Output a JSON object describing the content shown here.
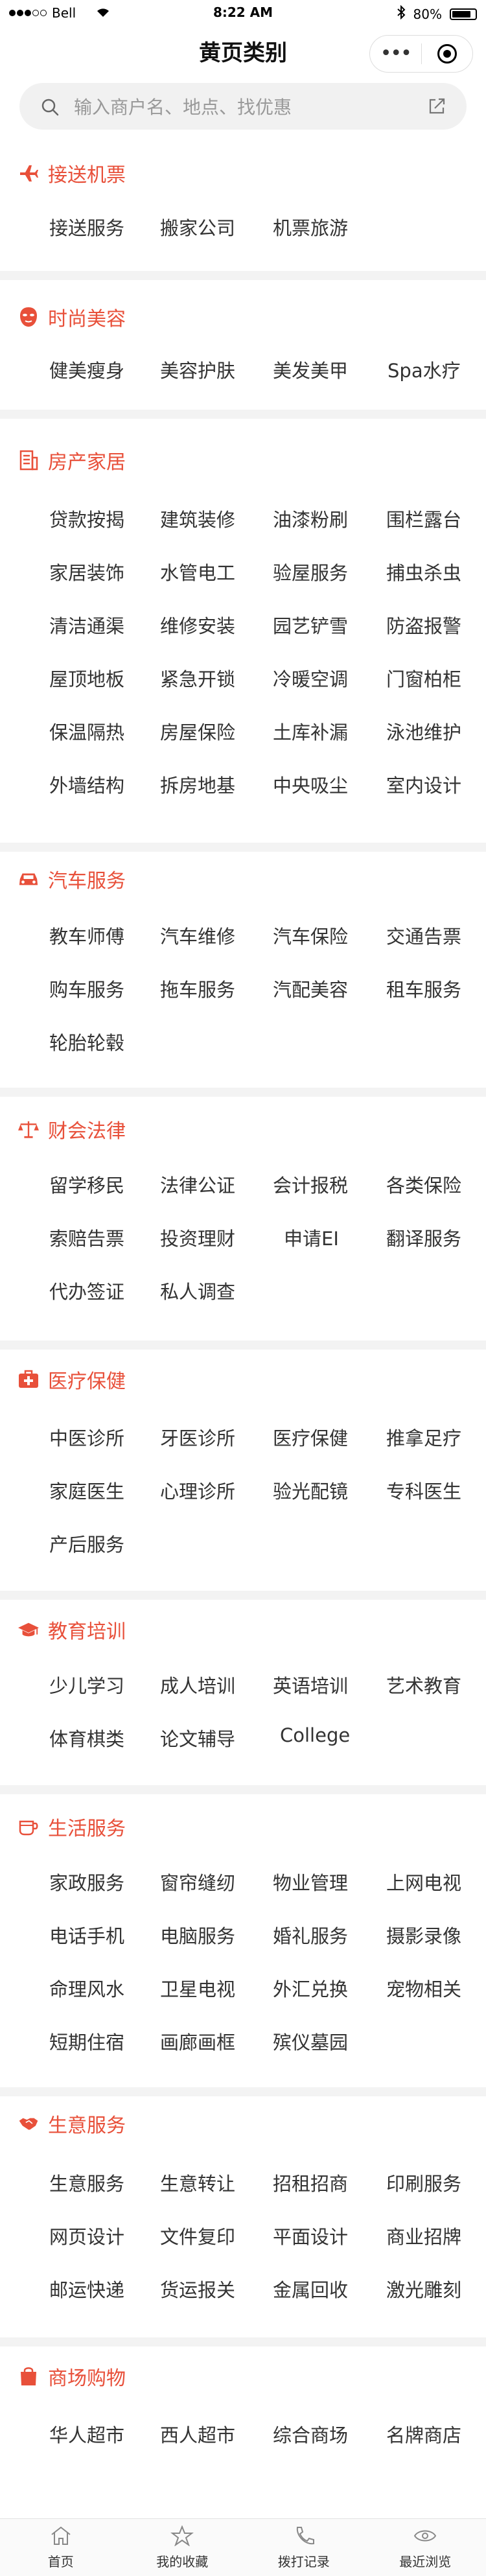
{
  "status_bar": {
    "carrier": "Bell",
    "time": "8:22 AM",
    "battery": "80%"
  },
  "nav": {
    "title": "黄页类别",
    "more_label": "•••"
  },
  "search": {
    "placeholder": "输入商户名、地点、找优惠"
  },
  "colors": {
    "accent": "#e8503a",
    "text": "#333333",
    "divider": "#f3f3f3"
  },
  "sections": [
    {
      "icon": "airplane-icon",
      "title": "接送机票",
      "items": [
        "接送服务",
        "搬家公司",
        "机票旅游"
      ]
    },
    {
      "icon": "face-mask-icon",
      "title": "时尚美容",
      "items": [
        "健美瘦身",
        "美容护肤",
        "美发美甲",
        "Spa水疗"
      ]
    },
    {
      "icon": "building-icon",
      "title": "房产家居",
      "items": [
        "贷款按揭",
        "建筑装修",
        "油漆粉刷",
        "围栏露台",
        "家居装饰",
        "水管电工",
        "验屋服务",
        "捕虫杀虫",
        "清洁通渠",
        "维修安装",
        "园艺铲雪",
        "防盗报警",
        "屋顶地板",
        "紧急开锁",
        "冷暖空调",
        "门窗柏柜",
        "保温隔热",
        "房屋保险",
        "土库补漏",
        "泳池维护",
        "外墙结构",
        "拆房地基",
        "中央吸尘",
        "室内设计"
      ]
    },
    {
      "icon": "car-icon",
      "title": "汽车服务",
      "items": [
        "教车师傅",
        "汽车维修",
        "汽车保险",
        "交通告票",
        "购车服务",
        "拖车服务",
        "汽配美容",
        "租车服务",
        "轮胎轮毂"
      ]
    },
    {
      "icon": "scales-icon",
      "title": "财会法律",
      "items": [
        "留学移民",
        "法律公证",
        "会计报税",
        "各类保险",
        "索赔告票",
        "投资理财",
        "申请EI",
        "翻译服务",
        "代办签证",
        "私人调查"
      ]
    },
    {
      "icon": "medical-kit-icon",
      "title": "医疗保健",
      "items": [
        "中医诊所",
        "牙医诊所",
        "医疗保健",
        "推拿足疗",
        "家庭医生",
        "心理诊所",
        "验光配镜",
        "专科医生",
        "产后服务"
      ]
    },
    {
      "icon": "graduation-cap-icon",
      "title": "教育培训",
      "items": [
        "少儿学习",
        "成人培训",
        "英语培训",
        "艺术教育",
        "体育棋类",
        "论文辅导",
        "College"
      ]
    },
    {
      "icon": "coffee-cup-icon",
      "title": "生活服务",
      "items": [
        "家政服务",
        "窗帘缝纫",
        "物业管理",
        "上网电视",
        "电话手机",
        "电脑服务",
        "婚礼服务",
        "摄影录像",
        "命理风水",
        "卫星电视",
        "外汇兑换",
        "宠物相关",
        "短期住宿",
        "画廊画框",
        "殡仪墓园"
      ]
    },
    {
      "icon": "handshake-icon",
      "title": "生意服务",
      "items": [
        "生意服务",
        "生意转让",
        "招租招商",
        "印刷服务",
        "网页设计",
        "文件复印",
        "平面设计",
        "商业招牌",
        "邮运快递",
        "货运报关",
        "金属回收",
        "激光雕刻"
      ]
    },
    {
      "icon": "shopping-bag-icon",
      "title": "商场购物",
      "items": [
        "华人超市",
        "西人超市",
        "综合商场",
        "名牌商店"
      ]
    }
  ],
  "tabbar": [
    {
      "icon": "home-icon",
      "label": "首页"
    },
    {
      "icon": "star-icon",
      "label": "我的收藏"
    },
    {
      "icon": "phone-icon",
      "label": "拨打记录"
    },
    {
      "icon": "eye-icon",
      "label": "最近浏览"
    }
  ]
}
